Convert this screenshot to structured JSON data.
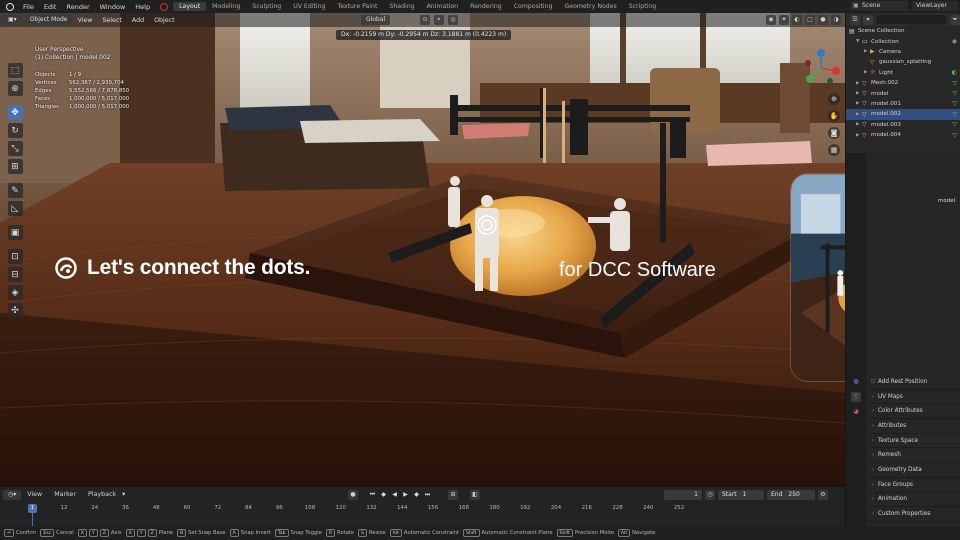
{
  "topbar": {
    "menus": [
      "File",
      "Edit",
      "Render",
      "Window",
      "Help"
    ],
    "workspaces": [
      "Layout",
      "Modeling",
      "Sculpting",
      "UV Editing",
      "Texture Paint",
      "Shading",
      "Animation",
      "Rendering",
      "Compositing",
      "Geometry Nodes",
      "Scripting"
    ],
    "active_workspace": "Layout",
    "scene": "Scene",
    "view_layer": "ViewLayer"
  },
  "viewport_header": {
    "mode": "Object Mode",
    "menus": [
      "View",
      "Select",
      "Add",
      "Object"
    ],
    "orientation": "Global"
  },
  "delta_readout": "Dx: -0.2159 m   Dy: -0.2954 m   Dz: 3.1881 m (0.4223 m)",
  "overlay": {
    "view_name": "User Perspective",
    "collection_line": "(1) Collection | model.002",
    "stats": [
      {
        "k": "Objects",
        "v": "1 / 9"
      },
      {
        "k": "Vertices",
        "v": "562,367 / 2,939,704"
      },
      {
        "k": "Edges",
        "v": "5,552,566 / 7,878,850"
      },
      {
        "k": "Faces",
        "v": "1,000,000 / 5,017,000"
      },
      {
        "k": "Triangles",
        "v": "1,000,000 / 5,017,000"
      }
    ]
  },
  "banner": {
    "headline": "Let's connect the dots.",
    "subline": "for DCC Software"
  },
  "outliner": {
    "root": "Scene Collection",
    "items": [
      {
        "label": "Collection",
        "icon": "collection-icon",
        "indent": 1
      },
      {
        "label": "Camera",
        "icon": "camera-icon",
        "indent": 2
      },
      {
        "label": "gaussian_splatting",
        "icon": "mesh-icon",
        "indent": 2
      },
      {
        "label": "Light",
        "icon": "light-icon",
        "indent": 2
      },
      {
        "label": "Mesh.002",
        "icon": "mesh-icon",
        "indent": 1
      },
      {
        "label": "model",
        "icon": "mesh-icon",
        "indent": 1
      },
      {
        "label": "model.001",
        "icon": "mesh-icon",
        "indent": 1
      },
      {
        "label": "model.002",
        "icon": "mesh-icon",
        "indent": 1,
        "selected": true
      },
      {
        "label": "model.003",
        "icon": "mesh-icon",
        "indent": 1
      },
      {
        "label": "model.004",
        "icon": "mesh-icon",
        "indent": 1
      }
    ]
  },
  "properties": {
    "first_label": "Add Rest Position",
    "panels": [
      "UV Maps",
      "Color Attributes",
      "Attributes",
      "Texture Space",
      "Remesh",
      "Geometry Data",
      "Face Groups",
      "Animation",
      "Custom Properties"
    ],
    "side_label": "model"
  },
  "timeline": {
    "menus": [
      "View",
      "Marker",
      "Playback"
    ],
    "current_frame": "1",
    "start_label": "Start",
    "start": "1",
    "end_label": "End",
    "end": "250",
    "ticks": [
      "12",
      "24",
      "36",
      "48",
      "60",
      "72",
      "84",
      "96",
      "108",
      "120",
      "132",
      "144",
      "156",
      "168",
      "180",
      "192",
      "204",
      "216",
      "228",
      "240",
      "252"
    ],
    "playhead": "1"
  },
  "statusbar": [
    {
      "keys": [
        "⏎"
      ],
      "label": "Confirm"
    },
    {
      "keys": [
        "Esc"
      ],
      "label": "Cancel"
    },
    {
      "keys": [
        "X",
        "Y",
        "Z"
      ],
      "label": "Axis"
    },
    {
      "keys": [
        "X",
        "Y",
        "Z"
      ],
      "label": "Plane"
    },
    {
      "keys": [
        "B"
      ],
      "label": "Set Snap Base"
    },
    {
      "keys": [
        "A"
      ],
      "label": "Snap Invert"
    },
    {
      "keys": [
        "Tab"
      ],
      "label": "Snap Toggle"
    },
    {
      "keys": [
        "R"
      ],
      "label": "Rotate"
    },
    {
      "keys": [
        "S"
      ],
      "label": "Resize"
    },
    {
      "keys": [
        "Alt"
      ],
      "label": "Automatic Constraint"
    },
    {
      "keys": [
        "Shift"
      ],
      "label": "Automatic Constraint Plane"
    },
    {
      "keys": [
        "Shift"
      ],
      "label": "Precision Mode"
    },
    {
      "keys": [
        "Alt"
      ],
      "label": "Navigate"
    }
  ],
  "colors": {
    "accent": "#4772b3",
    "selection_row": "#334d80",
    "panel_bg": "#262626"
  }
}
